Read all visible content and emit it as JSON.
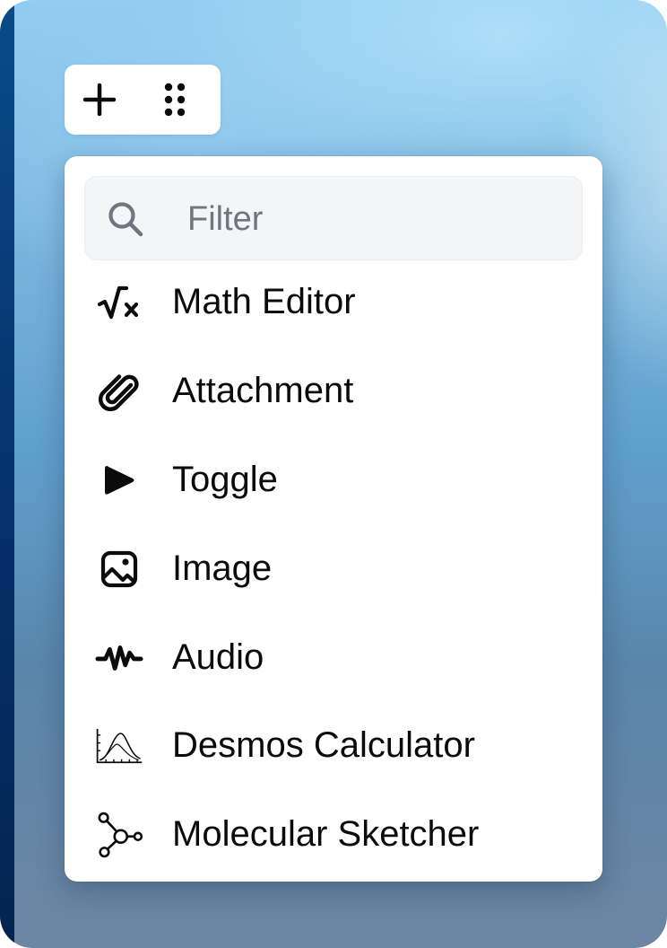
{
  "toolbar": {
    "add_icon": "plus-icon",
    "drag_icon": "drag-handle-icon"
  },
  "menu": {
    "filter": {
      "placeholder": "Filter",
      "value": "",
      "icon": "search-icon"
    },
    "items": [
      {
        "label": "Math Editor",
        "icon": "square-root-icon"
      },
      {
        "label": "Attachment",
        "icon": "paperclip-icon"
      },
      {
        "label": "Toggle",
        "icon": "play-triangle-icon"
      },
      {
        "label": "Image",
        "icon": "image-icon"
      },
      {
        "label": "Audio",
        "icon": "audio-wave-icon"
      },
      {
        "label": "Desmos Calculator",
        "icon": "bell-curve-graph-icon"
      },
      {
        "label": "Molecular Sketcher",
        "icon": "molecule-icon"
      }
    ]
  },
  "colors": {
    "text": "#0b0b0b",
    "placeholder": "#6f7680",
    "filter_bg": "#f4f5f6",
    "menu_bg": "#ffffff"
  }
}
